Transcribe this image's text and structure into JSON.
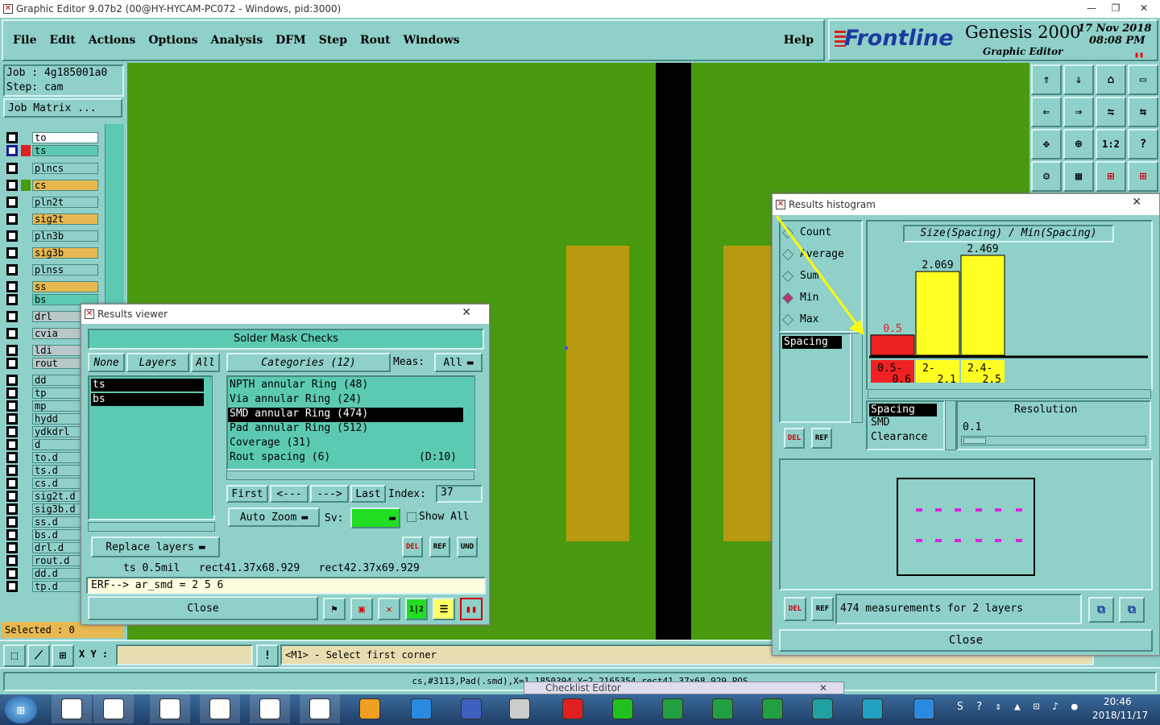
{
  "app": {
    "title": "Graphic Editor 9.07b2 (00@HY-HYCAM-PC072 - Windows, pid:3000)"
  },
  "menu": [
    "File",
    "Edit",
    "Actions",
    "Options",
    "Analysis",
    "DFM",
    "Step",
    "Rout",
    "Windows"
  ],
  "help": "Help",
  "brand": {
    "logo": "Frontline",
    "product": "Genesis 2000",
    "subtitle": "Graphic Editor",
    "date": "17 Nov 2018",
    "time": "08:08 PM"
  },
  "job": {
    "job": "Job : 4g185001a0",
    "step": "Step: cam",
    "matrix": "Job Matrix ..."
  },
  "layers": [
    "to",
    "ts",
    "plncs",
    "cs",
    "pln2t",
    "sig2t",
    "pln3b",
    "sig3b",
    "plnss",
    "ss",
    "bs",
    "drl",
    "cvia",
    "ldi",
    "rout",
    "dd",
    "tp",
    "mp",
    "hydd",
    "ydkdrl",
    "d",
    "to.d",
    "ts.d",
    "cs.d",
    "sig2t.d",
    "sig3b.d",
    "ss.d",
    "bs.d",
    "drl.d",
    "rout.d",
    "dd.d",
    "tp.d"
  ],
  "selected": "Selected : 0",
  "bottom": {
    "xy_label": "X Y :",
    "xy_value": "",
    "prompt": "<M1> - Select first corner",
    "status": "cs,#3113,Pad(.smd),X=1.1850394,Y=2.2165354,rect41.37x68.929,POS"
  },
  "results_viewer": {
    "title": "Results viewer",
    "header": "Solder Mask Checks",
    "none": "None",
    "layers": "Layers",
    "all": "All",
    "categories": "Categories (12)",
    "meas_label": "Meas:",
    "meas_value": "All",
    "layer_items": [
      "ts",
      "bs"
    ],
    "category_items": [
      {
        "name": "NPTH annular Ring (48)",
        "extra": ""
      },
      {
        "name": "Via annular Ring (24)",
        "extra": ""
      },
      {
        "name": "SMD annular Ring (474)",
        "extra": ""
      },
      {
        "name": "Pad annular Ring (512)",
        "extra": ""
      },
      {
        "name": "Coverage (31)",
        "extra": ""
      },
      {
        "name": "Rout spacing (6)",
        "extra": "(D:10)"
      }
    ],
    "first": "First",
    "prev": "<---",
    "next": "--->",
    "last": "Last",
    "index_label": "Index:",
    "index_value": "37",
    "auto_zoom": "Auto Zoom",
    "sv_label": "Sv:",
    "show_all": "Show All",
    "replace_layers": "Replace layers",
    "info": "ts 0.5mil   rect41.37x68.929   rect42.37x69.929",
    "erf": "ERF--> ar_smd = 2 5 6",
    "close": "Close"
  },
  "histogram": {
    "title": "Results histogram",
    "modes": [
      "Count",
      "Average",
      "Sum",
      "Min",
      "Max"
    ],
    "selected_mode": "Min",
    "chart_title": "Size(Spacing) / Min(Spacing)",
    "spacing": "Spacing",
    "bars": [
      {
        "value": "0.5",
        "range": "0.5-0.6",
        "color": "#ee2222"
      },
      {
        "value": "2.069",
        "range": "2-2.1",
        "color": "#ffff22"
      },
      {
        "value": "2.469",
        "range": "2.4-2.5",
        "color": "#ffff22"
      }
    ],
    "types": [
      "Spacing",
      "SMD",
      "Clearance"
    ],
    "resolution_label": "Resolution",
    "resolution_value": "0.1",
    "summary": "474 measurements for 2 layers",
    "close": "Close"
  },
  "checklist": "Checklist Editor",
  "taskbar": {
    "time": "20:46",
    "date": "2018/11/17"
  }
}
